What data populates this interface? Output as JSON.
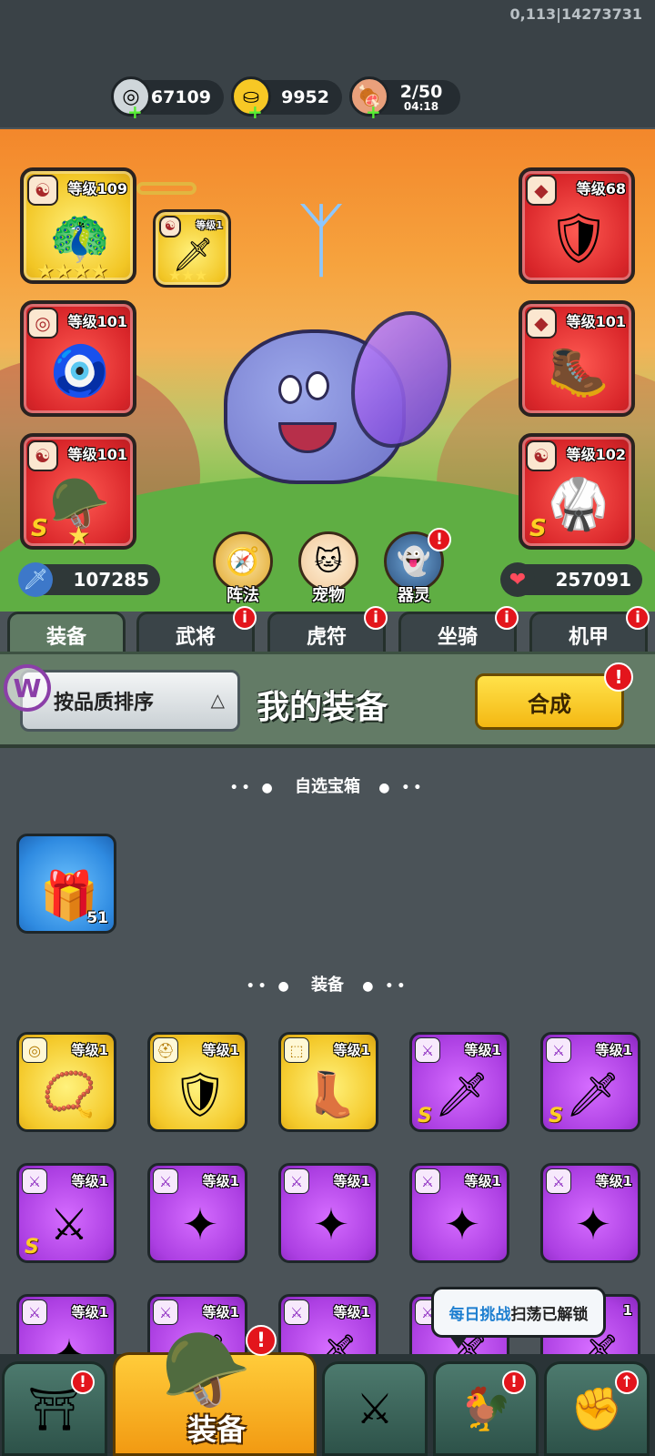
{
  "debug": {
    "coords": "0,113|14273731"
  },
  "resources": {
    "silver": {
      "value": "67109",
      "icon": "silver-coin-icon"
    },
    "gold": {
      "value": "9952",
      "icon": "gold-ingot-icon"
    },
    "stamina": {
      "value": "2/50",
      "timer": "04:18",
      "icon": "meat-icon"
    }
  },
  "hero": {
    "slots": [
      {
        "level": "等级109",
        "color": "gold",
        "art": "🦚",
        "badge": "☯",
        "stars": "★★★★"
      },
      {
        "level": "等级1",
        "color": "gold",
        "art": "🗡",
        "badge": "☯",
        "stars": "★★★"
      },
      {
        "level": "等级101",
        "color": "red",
        "art": "🧿",
        "badge": "◎"
      },
      {
        "level": "等级101",
        "color": "red",
        "art": "🪖",
        "badge": "☯",
        "s": "S",
        "stars": "★"
      },
      {
        "level": "等级68",
        "color": "red",
        "art": "🛡",
        "badge": "◆"
      },
      {
        "level": "等级101",
        "color": "red",
        "art": "🥾",
        "badge": "◆"
      },
      {
        "level": "等级102",
        "color": "red",
        "art": "🥋",
        "badge": "☯",
        "s": "S"
      }
    ],
    "attack": "107285",
    "health": "257091",
    "buttons": [
      {
        "label": "阵法",
        "icon": "formation-icon",
        "glyph": "🧭"
      },
      {
        "label": "宠物",
        "icon": "pet-cat-icon",
        "glyph": "🐱"
      },
      {
        "label": "器灵",
        "icon": "spirit-icon",
        "glyph": "👻"
      }
    ]
  },
  "tabs": [
    {
      "label": "装备",
      "active": true,
      "alert": false
    },
    {
      "label": "武将",
      "alert": true
    },
    {
      "label": "虎符",
      "alert": true
    },
    {
      "label": "坐骑",
      "alert": true
    },
    {
      "label": "机甲",
      "alert": true
    }
  ],
  "panel": {
    "sort_label": "按品质排序",
    "title": "我的装备",
    "merge_label": "合成"
  },
  "sections": {
    "chest_title": "自选宝箱",
    "equip_title": "装备"
  },
  "chest": {
    "count": "51",
    "icon": "mystery-chest-icon"
  },
  "items": [
    {
      "level": "等级1",
      "color": "gold",
      "art": "📿",
      "badge": "◎"
    },
    {
      "level": "等级1",
      "color": "gold",
      "art": "🛡",
      "badge": "⛑"
    },
    {
      "level": "等级1",
      "color": "gold",
      "art": "👢",
      "badge": "⬚"
    },
    {
      "level": "等级1",
      "color": "purple",
      "art": "🗡",
      "badge": "⚔",
      "s": "S"
    },
    {
      "level": "等级1",
      "color": "purple",
      "art": "🗡",
      "badge": "⚔",
      "s": "S"
    },
    {
      "level": "等级1",
      "color": "purple",
      "art": "⚔",
      "badge": "⚔",
      "s": "S"
    },
    {
      "level": "等级1",
      "color": "purple",
      "art": "✦",
      "badge": "⚔"
    },
    {
      "level": "等级1",
      "color": "purple",
      "art": "✦",
      "badge": "⚔"
    },
    {
      "level": "等级1",
      "color": "purple",
      "art": "✦",
      "badge": "⚔"
    },
    {
      "level": "等级1",
      "color": "purple",
      "art": "✦",
      "badge": "⚔"
    },
    {
      "level": "等级1",
      "color": "purple",
      "art": "✦",
      "badge": "⚔"
    },
    {
      "level": "等级1",
      "color": "purple",
      "art": "🗡",
      "badge": "⚔"
    },
    {
      "level": "等级1",
      "color": "purple",
      "art": "🗡",
      "badge": "⚔"
    },
    {
      "level": "等级1",
      "color": "purple",
      "art": "🗡",
      "badge": "⚔"
    },
    {
      "level": "1",
      "color": "purple",
      "art": "🗡",
      "badge": "⚔"
    }
  ],
  "tooltip": {
    "highlight": "每日挑战",
    "rest": "扫荡已解锁"
  },
  "bottom_nav": [
    {
      "label": "",
      "icon": "shop-gate-icon",
      "glyph": "⛩",
      "alert": true
    },
    {
      "label": "装备",
      "icon": "helmet-icon",
      "glyph": "🪖",
      "alert": true,
      "active": true
    },
    {
      "label": "",
      "icon": "battle-shield-icon",
      "glyph": "⚔"
    },
    {
      "label": "",
      "icon": "rooster-icon",
      "glyph": "🐓",
      "alert": true
    },
    {
      "label": "",
      "icon": "power-fist-icon",
      "glyph": "✊",
      "alert": true
    }
  ],
  "colors": {
    "alert": "#e3151c",
    "merge_button": "#f4b813",
    "purple_item": "#ac3fe2",
    "gold_item": "#f4c92a",
    "red_slot": "#d9262a"
  }
}
